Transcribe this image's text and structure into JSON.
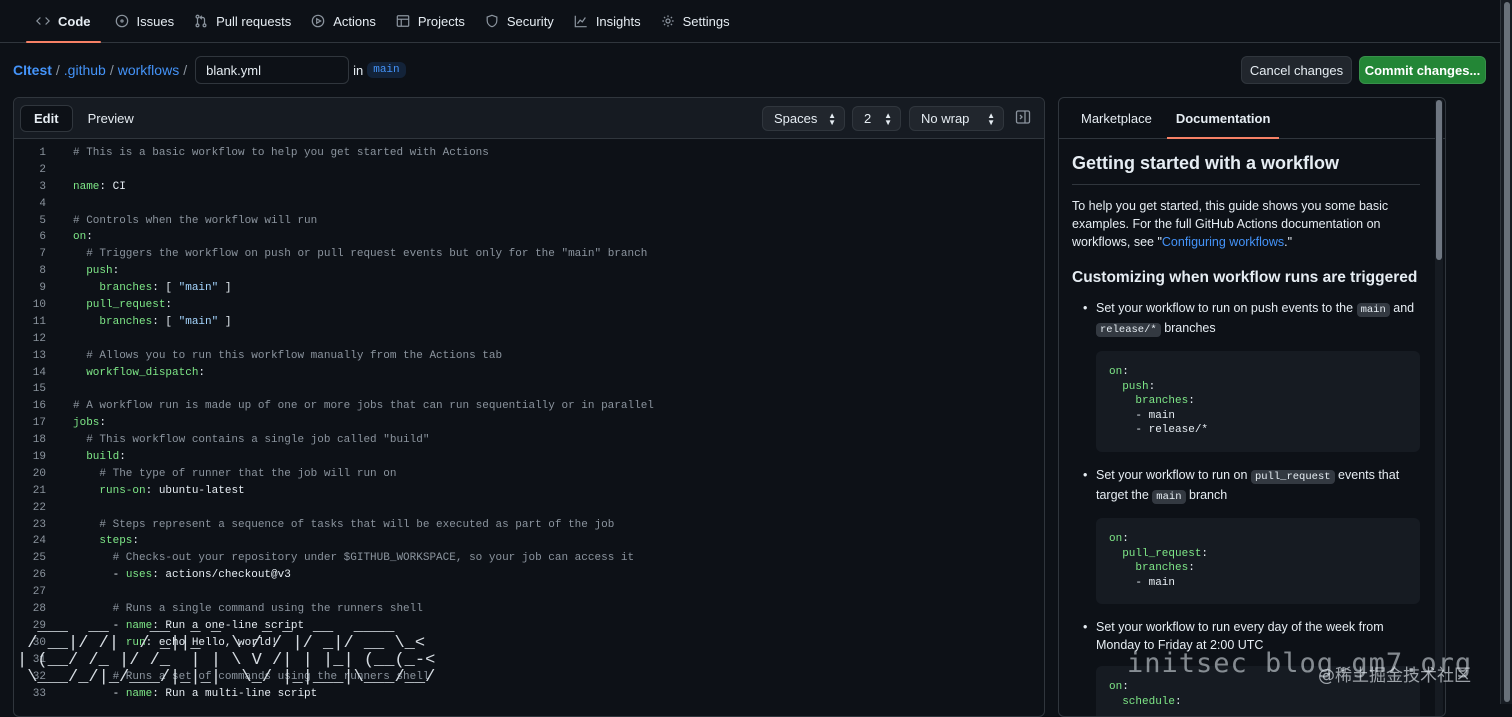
{
  "nav": {
    "tabs": [
      {
        "label": "Code",
        "icon": "code-icon"
      },
      {
        "label": "Issues",
        "icon": "issue-icon"
      },
      {
        "label": "Pull requests",
        "icon": "pull-request-icon"
      },
      {
        "label": "Actions",
        "icon": "play-icon"
      },
      {
        "label": "Projects",
        "icon": "table-icon"
      },
      {
        "label": "Security",
        "icon": "shield-icon"
      },
      {
        "label": "Insights",
        "icon": "graph-icon"
      },
      {
        "label": "Settings",
        "icon": "gear-icon"
      }
    ],
    "active": "Code"
  },
  "breadcrumb": {
    "repo": "CItest",
    "dir1": ".github",
    "dir2": "workflows",
    "separator": "/",
    "filename": "blank.yml",
    "in_label": "in",
    "branch": "main"
  },
  "actions": {
    "cancel": "Cancel changes",
    "commit": "Commit changes..."
  },
  "editor": {
    "mode_edit": "Edit",
    "mode_preview": "Preview",
    "indent_mode": "Spaces",
    "indent_size": "2",
    "wrap_mode": "No wrap",
    "lines": [
      "# This is a basic workflow to help you get started with Actions",
      "",
      "name: CI",
      "",
      "# Controls when the workflow will run",
      "on:",
      "  # Triggers the workflow on push or pull request events but only for the \"main\" branch",
      "  push:",
      "    branches: [ \"main\" ]",
      "  pull_request:",
      "    branches: [ \"main\" ]",
      "",
      "  # Allows you to run this workflow manually from the Actions tab",
      "  workflow_dispatch:",
      "",
      "# A workflow run is made up of one or more jobs that can run sequentially or in parallel",
      "jobs:",
      "  # This workflow contains a single job called \"build\"",
      "  build:",
      "    # The type of runner that the job will run on",
      "    runs-on: ubuntu-latest",
      "",
      "    # Steps represent a sequence of tasks that will be executed as part of the job",
      "    steps:",
      "      # Checks-out your repository under $GITHUB_WORKSPACE, so your job can access it",
      "      - uses: actions/checkout@v3",
      "",
      "      # Runs a single command using the runners shell",
      "      - name: Run a one-line script",
      "        run: echo Hello, world!",
      "",
      "      # Runs a set of commands using the runners shell",
      "      - name: Run a multi-line script"
    ]
  },
  "docs": {
    "tabs": [
      "Marketplace",
      "Documentation"
    ],
    "active_tab": "Documentation",
    "title": "Getting started with a workflow",
    "intro_before": "To help you get started, this guide shows you some basic examples. For the full GitHub Actions documentation on workflows, see \"",
    "intro_link": "Configuring workflows",
    "intro_after": ".\"",
    "section_title": "Customizing when workflow runs are triggered",
    "item1": {
      "t1": "Set your workflow to run on push events to the ",
      "c1": "main",
      "t2": " and ",
      "c2": "release/*",
      "t3": " branches"
    },
    "code1": "on:\n  push:\n    branches:\n    - main\n    - release/*",
    "item2": {
      "t1": "Set your workflow to run on ",
      "c1": "pull_request",
      "t2": " events that target the ",
      "c2": "main",
      "t3": " branch"
    },
    "code2": "on:\n  pull_request:\n    branches:\n    - main",
    "item3": {
      "t1": "Set your workflow to run every day of the week from Monday to Friday at 2:00 UTC"
    },
    "code3": "on:\n  schedule:"
  },
  "watermark": {
    "ascii": "  ___  __    __  _ _    _ _  __  ____\n / __|/ /|  / _||_   \\ / / |/ _|/ __ \\_<\n| (__/ /_ |/ /_  | | \\ V /| | |_| (__(_-<\n \\___/_/|_/___/|_|_|  \\_/ |_|___|\\___/__/",
    "site": "initsec blog.gm7.org",
    "credit": "@稀土掘金技术社区"
  },
  "colors": {
    "accent_tab": "#f78166",
    "link": "#4493f8",
    "commit_button": "#238636",
    "yaml_key": "#7ee787",
    "comment": "#8b949e"
  }
}
